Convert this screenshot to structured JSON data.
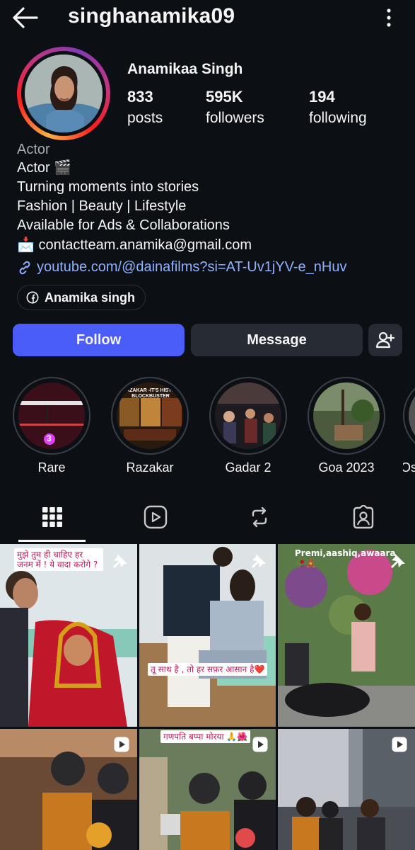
{
  "header": {
    "username": "singhanamika09"
  },
  "profile": {
    "display_name": "Anamikaa Singh",
    "stats": [
      {
        "value": "833",
        "label": "posts"
      },
      {
        "value": "595K",
        "label": "followers"
      },
      {
        "value": "194",
        "label": "following"
      }
    ],
    "category": "Actor",
    "bio_lines": [
      "Actor 🎬",
      "Turning moments into stories",
      "Fashion | Beauty | Lifestyle",
      "Available for Ads & Collaborations",
      "📩 contactteam.anamika@gmail.com"
    ],
    "link": "youtube.com/@dainafilms?si=AT-Uv1jYV-e_nHuv",
    "facebook_chip": "Anamika singh"
  },
  "actions": {
    "follow": "Follow",
    "message": "Message"
  },
  "highlights": [
    {
      "label": "Rare",
      "badge": "3"
    },
    {
      "label": "Razakar",
      "overlay_text": "RAZAKAR -IT'S HISTOR BLOCKBUSTER"
    },
    {
      "label": "Gadar 2"
    },
    {
      "label": "Goa 2023"
    },
    {
      "label": "Os"
    }
  ],
  "tabs": [
    "grid-icon",
    "reels-icon",
    "reposts-icon",
    "tagged-icon"
  ],
  "posts": [
    {
      "caption": "मुझे तुम ही चाहिए हर जनम में ! ये वादा करोगे ?",
      "badge": "pin-icon"
    },
    {
      "caption": "तू साथ है , तो हर सफ़र आसान है❤️",
      "badge": "pin-icon"
    },
    {
      "caption": "Premi,aashiq,awaara 🥀🧸",
      "badge": "pin-icon"
    },
    {
      "caption": "",
      "badge": "reel-icon"
    },
    {
      "caption": "गणपति बप्पा मोरया 🙏🌺",
      "badge": "reel-icon"
    },
    {
      "caption": "",
      "badge": "reel-icon"
    }
  ],
  "colors": {
    "background": "#0c0f14",
    "follow": "#4a5df9",
    "secondary_button": "#272b33",
    "link": "#8fb2ff"
  }
}
